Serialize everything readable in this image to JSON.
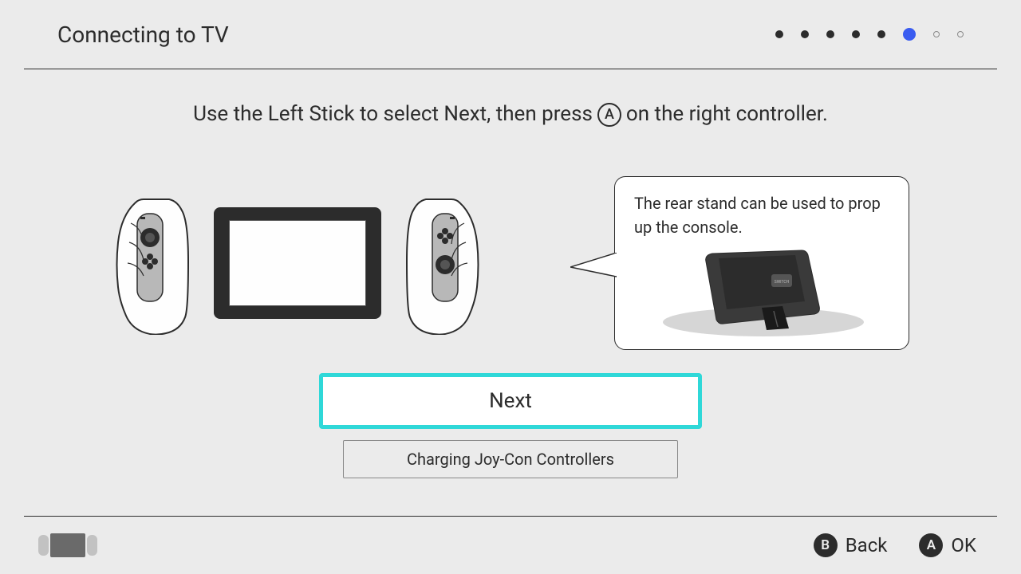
{
  "header": {
    "title": "Connecting to TV",
    "steps": {
      "total": 8,
      "current": 6
    }
  },
  "instruction": {
    "pre": "Use the Left Stick to select Next, then press",
    "btn_glyph": "A",
    "post": "on the right controller."
  },
  "callout": {
    "text": "The rear stand can be used to prop up the console."
  },
  "buttons": {
    "primary": "Next",
    "secondary": "Charging Joy-Con Controllers"
  },
  "footer": {
    "back_glyph": "B",
    "back_label": "Back",
    "ok_glyph": "A",
    "ok_label": "OK"
  }
}
